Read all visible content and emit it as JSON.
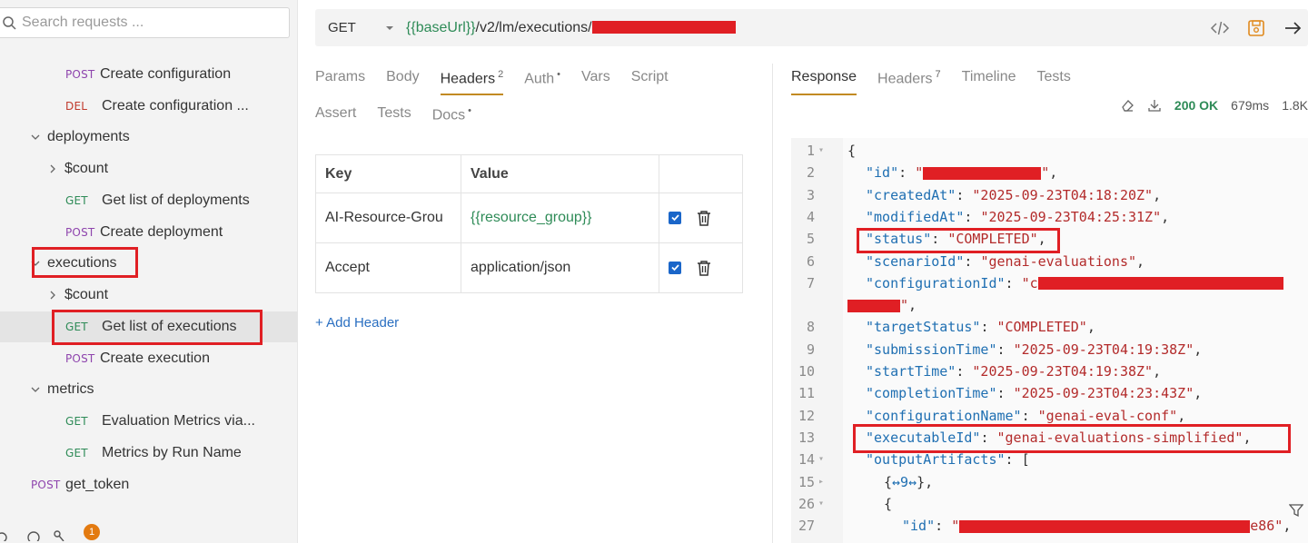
{
  "search": {
    "placeholder": "Search requests ..."
  },
  "sidebar": {
    "items": [
      {
        "type": "request",
        "method": "POST",
        "label": "Create configuration"
      },
      {
        "type": "request",
        "method": "DEL",
        "label": "Create configuration ..."
      },
      {
        "type": "folder",
        "label": "deployments"
      },
      {
        "type": "folder",
        "label": "$count"
      },
      {
        "type": "request",
        "method": "GET",
        "label": "Get list of deployments"
      },
      {
        "type": "request",
        "method": "POST",
        "label": "Create deployment"
      },
      {
        "type": "folder",
        "label": "executions"
      },
      {
        "type": "folder",
        "label": "$count"
      },
      {
        "type": "request",
        "method": "GET",
        "label": "Get list of executions"
      },
      {
        "type": "request",
        "method": "POST",
        "label": "Create execution"
      },
      {
        "type": "folder",
        "label": "metrics"
      },
      {
        "type": "request",
        "method": "GET",
        "label": "Evaluation Metrics via..."
      },
      {
        "type": "request",
        "method": "GET",
        "label": "Metrics by Run Name"
      },
      {
        "type": "request",
        "method": "POST",
        "label": "get_token"
      }
    ],
    "notification_count": "1"
  },
  "request": {
    "method": "GET",
    "url_var": "{{baseUrl}}",
    "url_path": "/v2/lm/executions/"
  },
  "request_tabs": {
    "row1": [
      {
        "label": "Params",
        "sup": ""
      },
      {
        "label": "Body",
        "sup": ""
      },
      {
        "label": "Headers",
        "sup": "2"
      },
      {
        "label": "Auth",
        "sup": "•"
      },
      {
        "label": "Vars",
        "sup": ""
      },
      {
        "label": "Script",
        "sup": ""
      }
    ],
    "row2": [
      {
        "label": "Assert",
        "sup": ""
      },
      {
        "label": "Tests",
        "sup": ""
      },
      {
        "label": "Docs",
        "sup": "•"
      }
    ],
    "active": "Headers"
  },
  "headers_table": {
    "columns": [
      "Key",
      "Value"
    ],
    "rows": [
      {
        "key": "AI-Resource-Grou",
        "value": "{{resource_group}}",
        "enabled": true
      },
      {
        "key": "Accept",
        "value": "application/json",
        "enabled": true
      }
    ],
    "add_label": "+ Add Header"
  },
  "response_tabs": [
    {
      "label": "Response",
      "sup": ""
    },
    {
      "label": "Headers",
      "sup": "7"
    },
    {
      "label": "Timeline",
      "sup": ""
    },
    {
      "label": "Tests",
      "sup": ""
    }
  ],
  "response_meta": {
    "status": "200 OK",
    "time": "679ms",
    "size": "1.8K"
  },
  "response_lines": [
    {
      "n": "1",
      "fold": "▾",
      "indent": 0,
      "parts": [
        [
          "p",
          "{"
        ]
      ]
    },
    {
      "n": "2",
      "fold": "",
      "indent": 1,
      "parts": [
        [
          "k",
          "\"id\""
        ],
        [
          "p",
          ": "
        ],
        [
          "s",
          "\""
        ],
        [
          "r",
          "130"
        ],
        [
          "s",
          "\""
        ],
        [
          "p",
          ","
        ]
      ]
    },
    {
      "n": "3",
      "fold": "",
      "indent": 1,
      "parts": [
        [
          "k",
          "\"createdAt\""
        ],
        [
          "p",
          ": "
        ],
        [
          "s",
          "\"2025-09-23T04:18:20Z\""
        ],
        [
          "p",
          ","
        ]
      ]
    },
    {
      "n": "4",
      "fold": "",
      "indent": 1,
      "parts": [
        [
          "k",
          "\"modifiedAt\""
        ],
        [
          "p",
          ": "
        ],
        [
          "s",
          "\"2025-09-23T04:25:31Z\""
        ],
        [
          "p",
          ","
        ]
      ]
    },
    {
      "n": "5",
      "fold": "",
      "indent": 1,
      "parts": [
        [
          "k",
          "\"status\""
        ],
        [
          "p",
          ": "
        ],
        [
          "s",
          "\"COMPLETED\""
        ],
        [
          "p",
          ","
        ]
      ]
    },
    {
      "n": "6",
      "fold": "",
      "indent": 1,
      "parts": [
        [
          "k",
          "\"scenarioId\""
        ],
        [
          "p",
          ": "
        ],
        [
          "s",
          "\"genai-evaluations\""
        ],
        [
          "p",
          ","
        ]
      ]
    },
    {
      "n": "7",
      "fold": "",
      "indent": 1,
      "parts": [
        [
          "k",
          "\"configurationId\""
        ],
        [
          "p",
          ": "
        ],
        [
          "s",
          "\"c"
        ],
        [
          "r",
          "270"
        ]
      ]
    },
    {
      "n": "",
      "fold": "",
      "indent": 0,
      "parts": [
        [
          "r",
          "58"
        ],
        [
          "s",
          "\""
        ],
        [
          "p",
          ","
        ]
      ]
    },
    {
      "n": "8",
      "fold": "",
      "indent": 1,
      "parts": [
        [
          "k",
          "\"targetStatus\""
        ],
        [
          "p",
          ": "
        ],
        [
          "s",
          "\"COMPLETED\""
        ],
        [
          "p",
          ","
        ]
      ]
    },
    {
      "n": "9",
      "fold": "",
      "indent": 1,
      "parts": [
        [
          "k",
          "\"submissionTime\""
        ],
        [
          "p",
          ": "
        ],
        [
          "s",
          "\"2025-09-23T04:19:38Z\""
        ],
        [
          "p",
          ","
        ]
      ]
    },
    {
      "n": "10",
      "fold": "",
      "indent": 1,
      "parts": [
        [
          "k",
          "\"startTime\""
        ],
        [
          "p",
          ": "
        ],
        [
          "s",
          "\"2025-09-23T04:19:38Z\""
        ],
        [
          "p",
          ","
        ]
      ]
    },
    {
      "n": "11",
      "fold": "",
      "indent": 1,
      "parts": [
        [
          "k",
          "\"completionTime\""
        ],
        [
          "p",
          ": "
        ],
        [
          "s",
          "\"2025-09-23T04:23:43Z\""
        ],
        [
          "p",
          ","
        ]
      ]
    },
    {
      "n": "12",
      "fold": "",
      "indent": 1,
      "parts": [
        [
          "k",
          "\"configurationName\""
        ],
        [
          "p",
          ": "
        ],
        [
          "s",
          "\"genai-eval-conf\""
        ],
        [
          "p",
          ","
        ]
      ]
    },
    {
      "n": "13",
      "fold": "",
      "indent": 1,
      "parts": [
        [
          "k",
          "\"executableId\""
        ],
        [
          "p",
          ": "
        ],
        [
          "s",
          "\"genai-evaluations-simplified\""
        ],
        [
          "p",
          ","
        ]
      ]
    },
    {
      "n": "14",
      "fold": "▾",
      "indent": 1,
      "parts": [
        [
          "k",
          "\"outputArtifacts\""
        ],
        [
          "p",
          ": ["
        ]
      ]
    },
    {
      "n": "15",
      "fold": "▸",
      "indent": 2,
      "parts": [
        [
          "p",
          "{"
        ],
        [
          "k",
          "↔9↔"
        ],
        [
          "p",
          "},"
        ]
      ]
    },
    {
      "n": "26",
      "fold": "▾",
      "indent": 2,
      "parts": [
        [
          "p",
          "{"
        ]
      ]
    },
    {
      "n": "27",
      "fold": "",
      "indent": 3,
      "parts": [
        [
          "k",
          "\"id\""
        ],
        [
          "p",
          ": "
        ],
        [
          "s",
          "\""
        ],
        [
          "r",
          "320"
        ],
        [
          "s",
          "e86\""
        ],
        [
          "p",
          ","
        ]
      ]
    }
  ],
  "colors": {
    "accent": "#c28a22",
    "get": "#2e8b57",
    "post": "#8e44ad",
    "del": "#c0392b",
    "annotation": "#e01f24"
  }
}
